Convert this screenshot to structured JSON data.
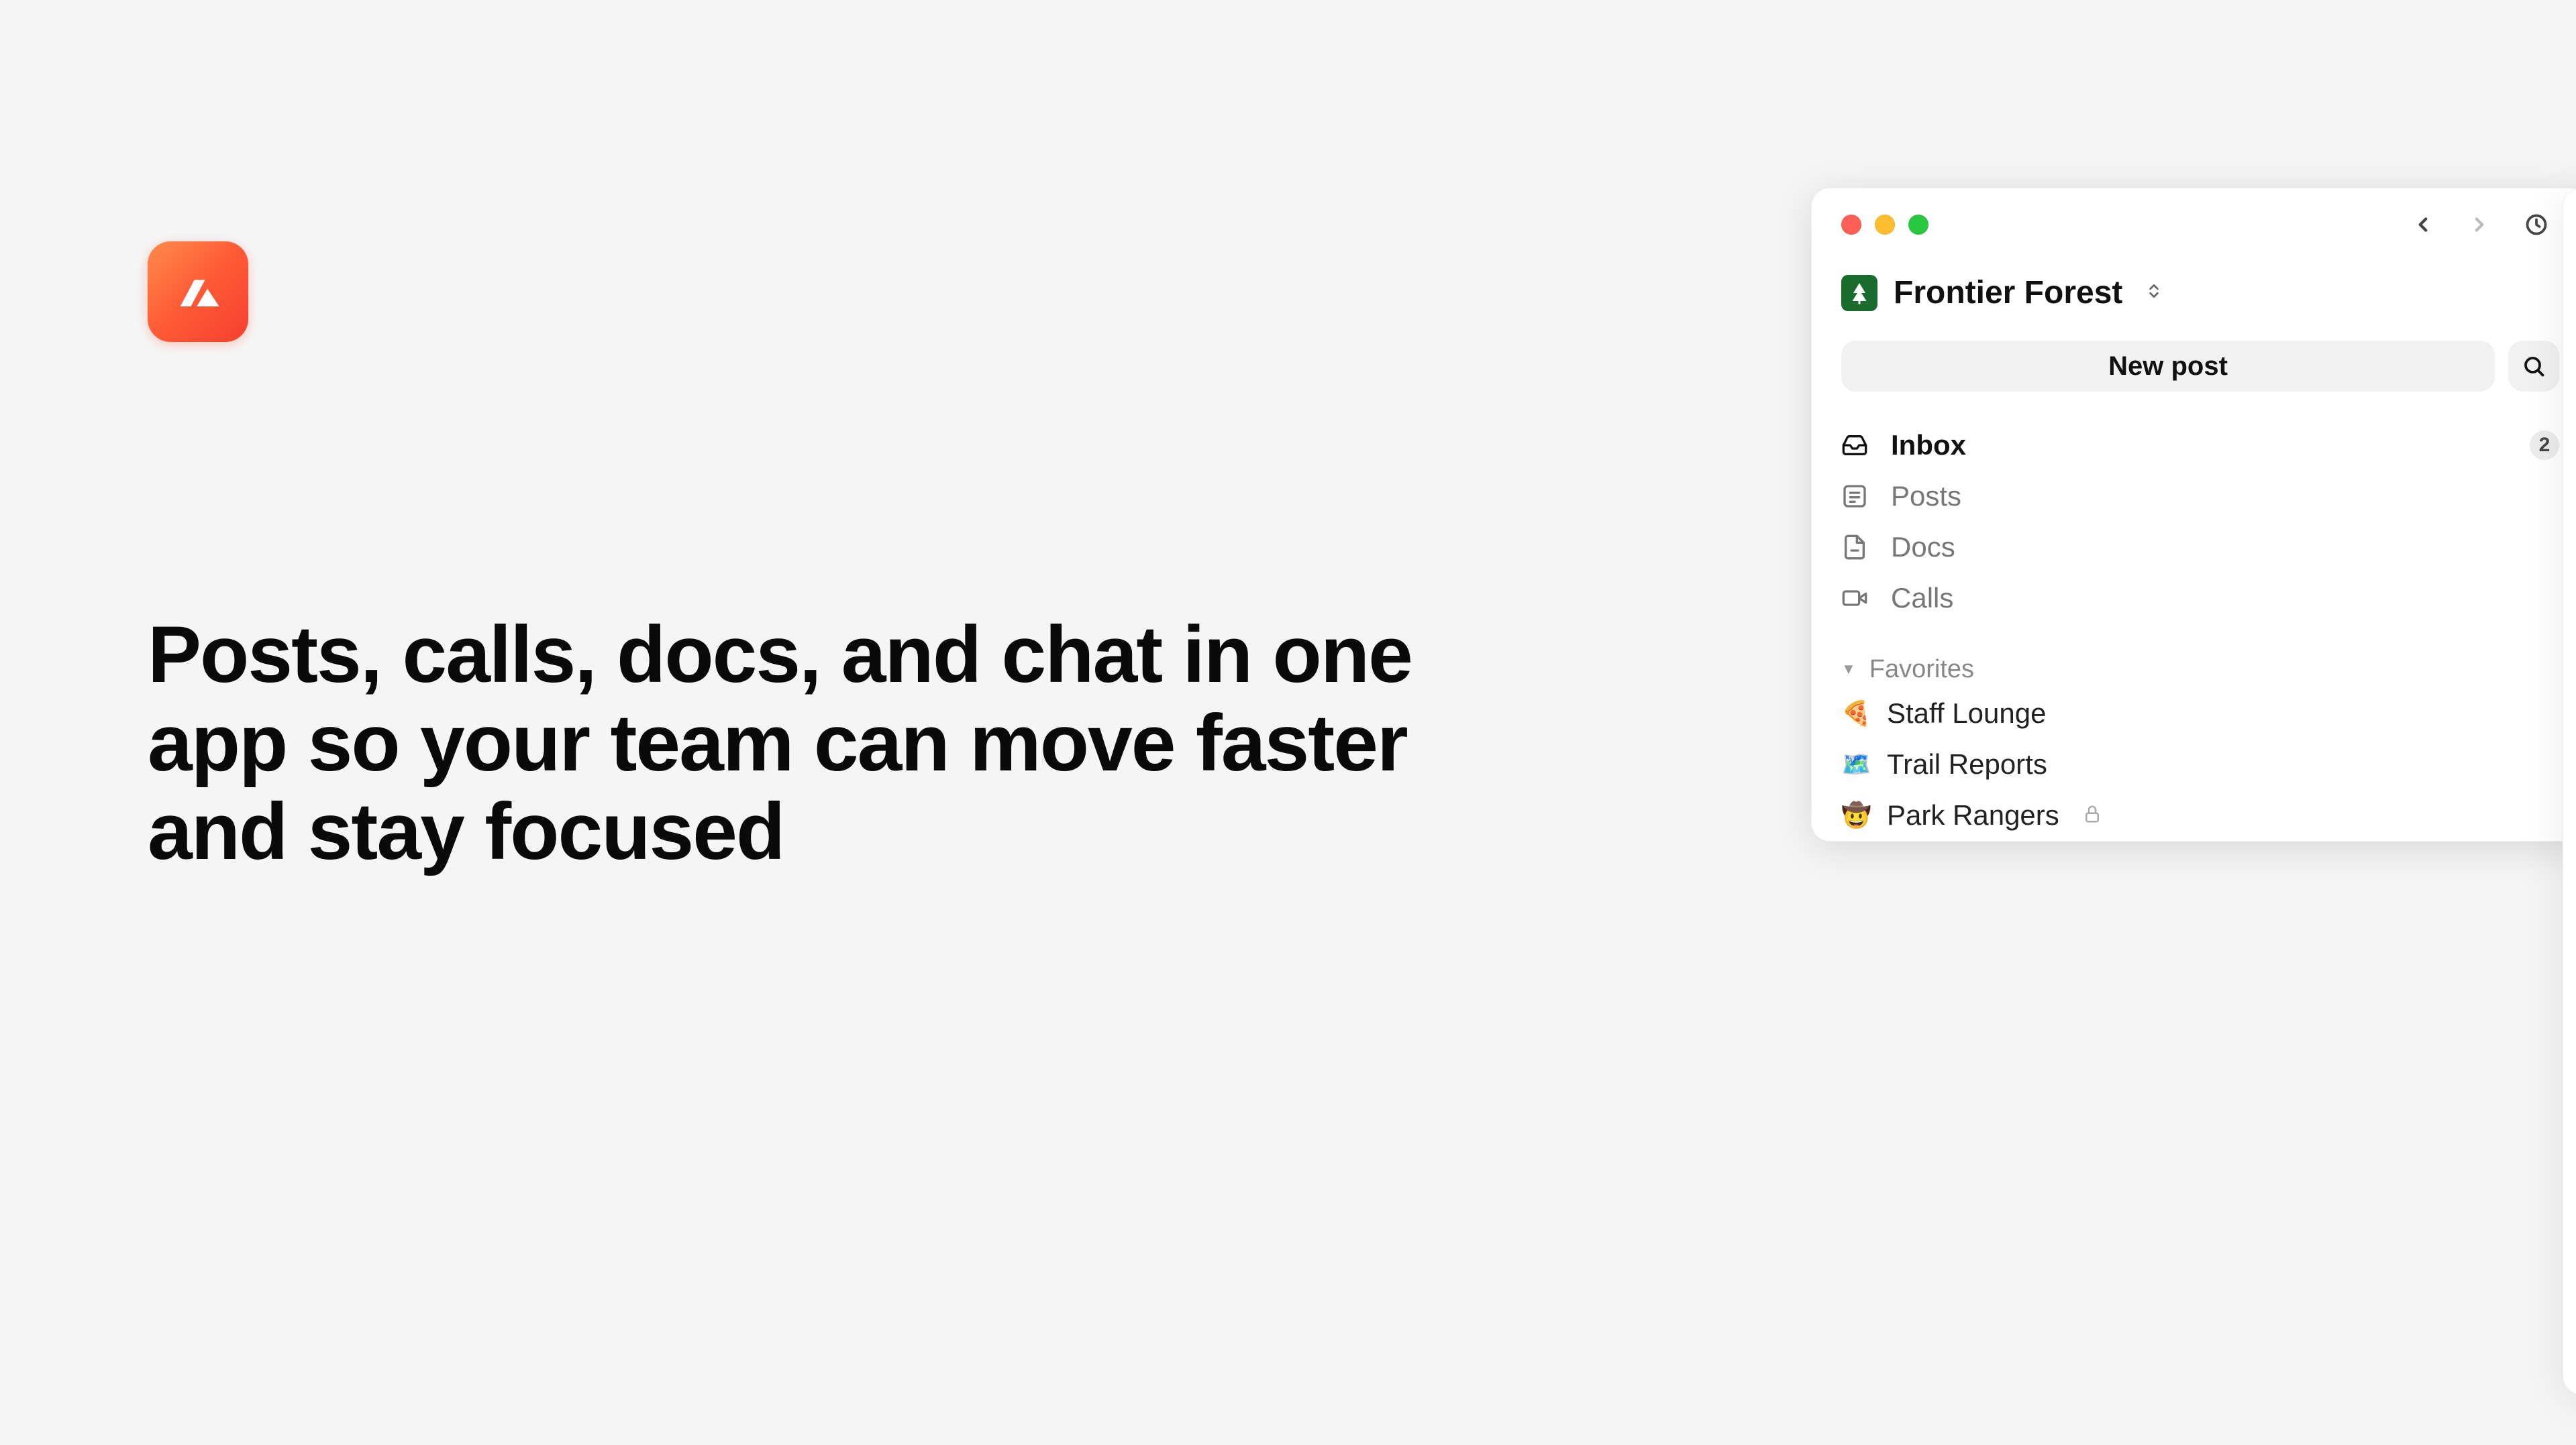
{
  "marketing": {
    "headline": "Posts, calls, docs, and chat in one app so your team can move faster and stay focused"
  },
  "workspace": {
    "name": "Frontier Forest"
  },
  "actions": {
    "new_post_label": "New post"
  },
  "nav": {
    "inbox": {
      "label": "Inbox",
      "badge": "2"
    },
    "posts": {
      "label": "Posts"
    },
    "docs": {
      "label": "Docs"
    },
    "calls": {
      "label": "Calls"
    }
  },
  "favorites": {
    "header": "Favorites",
    "items": [
      {
        "emoji": "🍕",
        "label": "Staff Lounge",
        "locked": false
      },
      {
        "emoji": "🗺️",
        "label": "Trail Reports",
        "locked": false
      },
      {
        "emoji": "🤠",
        "label": "Park Rangers",
        "locked": true
      }
    ]
  }
}
